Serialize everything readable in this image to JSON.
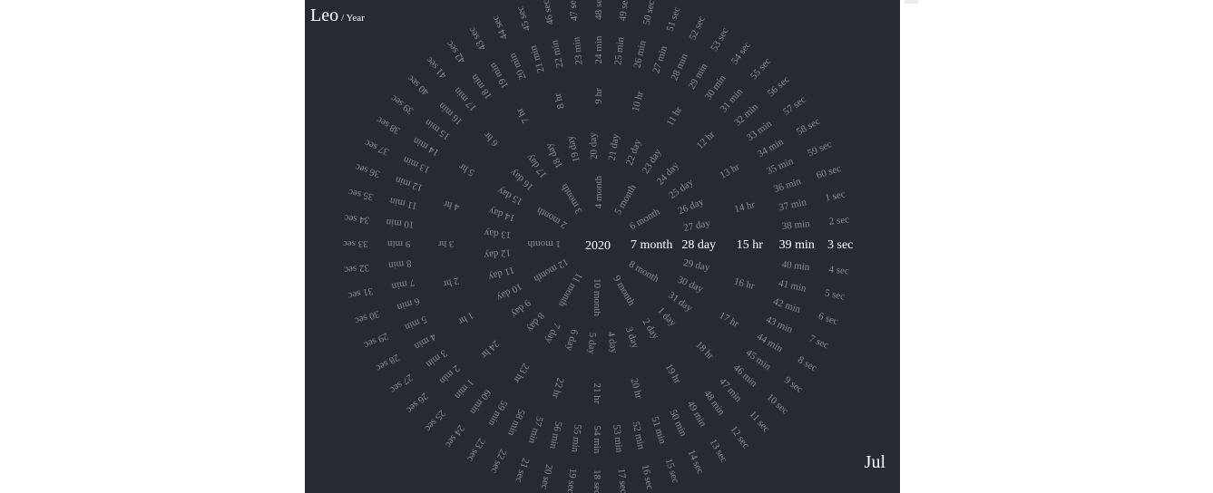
{
  "title": {
    "main": "Leo",
    "sub": "/ Year"
  },
  "month_label": "Jul",
  "current": {
    "year": "2020",
    "month": 7,
    "day": 28,
    "hour": 15,
    "minute": 39,
    "second": 3
  },
  "units": {
    "month": "month",
    "day": "day",
    "hour": "hr",
    "minute": "min",
    "second": "sec"
  },
  "rings": [
    {
      "key": "month",
      "count": 12,
      "start": 1
    },
    {
      "key": "day",
      "count": 31,
      "start": 1
    },
    {
      "key": "hour",
      "count": 24,
      "start": 1
    },
    {
      "key": "minute",
      "count": 60,
      "start": 1
    },
    {
      "key": "second",
      "count": 60,
      "start": 1
    }
  ],
  "colors": {
    "background": "#272a31",
    "label": "#8a8d93",
    "current": "#ffffff"
  }
}
